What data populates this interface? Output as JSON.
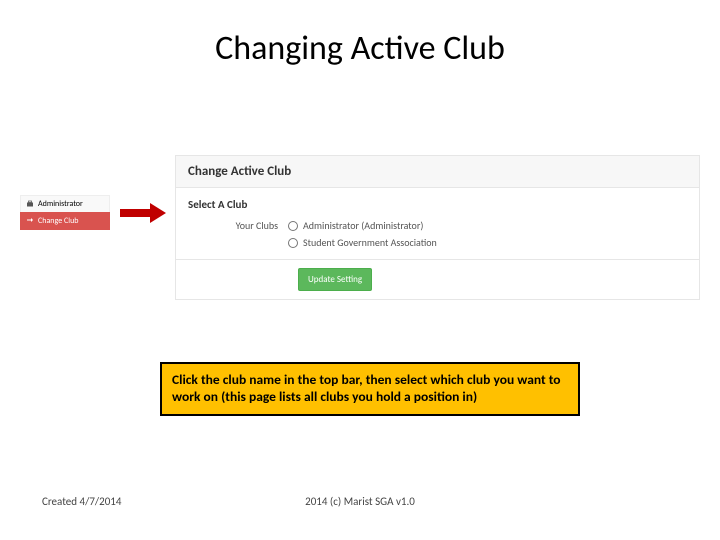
{
  "title": "Changing Active Club",
  "sidebar": {
    "items": [
      {
        "label": "Administrator",
        "icon": "briefcase"
      },
      {
        "label": "Change Club",
        "icon": "swap"
      }
    ]
  },
  "panel": {
    "heading": "Change Active Club",
    "sub_heading": "Select A Club",
    "form_label": "Your Clubs",
    "options": [
      "Administrator (Administrator)",
      "Student Government Association"
    ],
    "button": "Update Setting"
  },
  "callout": "Click the club name in the top bar, then select which club you want to work on (this page lists all clubs you hold a position in)",
  "footer": {
    "created": "Created 4/7/2014",
    "copyright": "2014 (c) Marist SGA v1.0"
  }
}
